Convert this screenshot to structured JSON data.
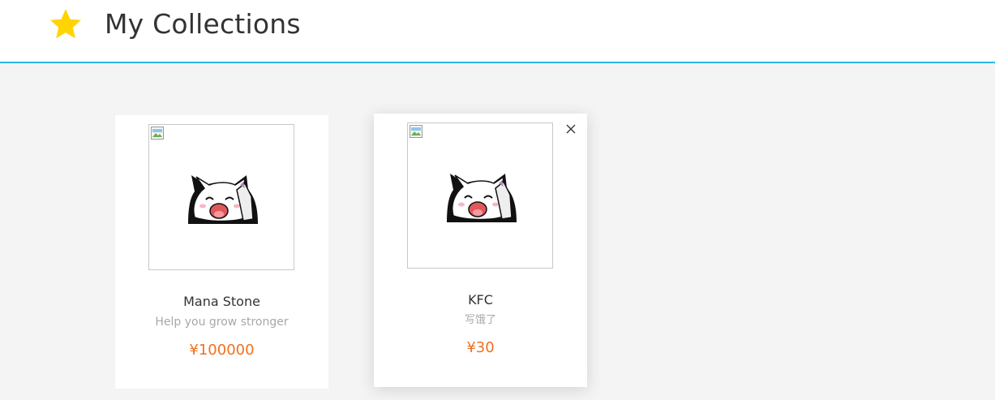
{
  "header": {
    "icon": "star-icon",
    "title": "My Collections",
    "star_color": "#ffd400",
    "border_color": "#29b6e0"
  },
  "collections": [
    {
      "name": "Mana Stone",
      "description": "Help you grow stronger",
      "price": "¥100000",
      "image_icon": "broken-image-icon",
      "show_close": false
    },
    {
      "name": "KFC",
      "description": "写饿了",
      "price": "¥30",
      "image_icon": "broken-image-icon",
      "close_icon": "close-icon",
      "show_close": true
    }
  ],
  "colors": {
    "price": "#f2701e",
    "background": "#f4f4f4"
  }
}
